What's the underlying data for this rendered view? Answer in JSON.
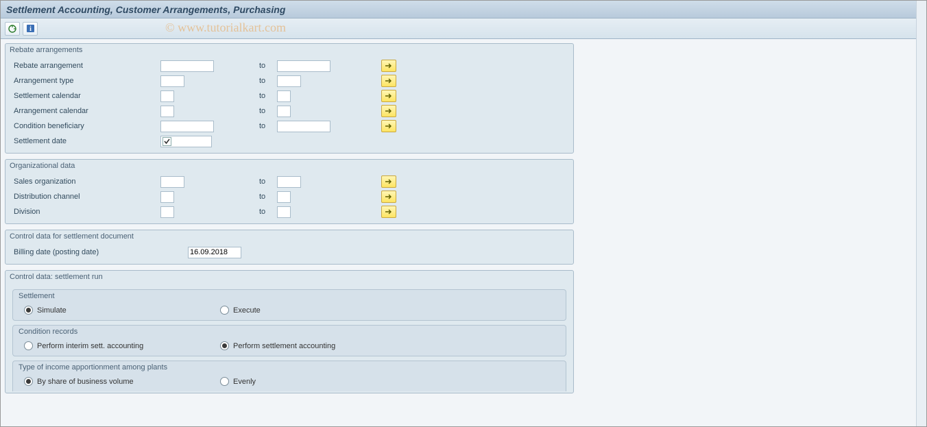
{
  "header": {
    "title": "Settlement Accounting, Customer Arrangements, Purchasing"
  },
  "watermark": "© www.tutorialkart.com",
  "toolbar": {
    "execute_icon": "execute",
    "info_icon": "info"
  },
  "groups": {
    "rebate": {
      "title": "Rebate arrangements",
      "rows": {
        "rebate_arrangement": {
          "label": "Rebate arrangement",
          "to": "to",
          "from_val": "",
          "to_val": "",
          "width": "med"
        },
        "arrangement_type": {
          "label": "Arrangement type",
          "to": "to",
          "from_val": "",
          "to_val": "",
          "width": "narrow"
        },
        "settlement_cal": {
          "label": "Settlement calendar",
          "to": "to",
          "from_val": "",
          "to_val": "",
          "width": "narrow"
        },
        "arrangement_cal": {
          "label": "Arrangement calendar",
          "to": "to",
          "from_val": "",
          "to_val": "",
          "width": "narrow"
        },
        "cond_beneficiary": {
          "label": "Condition beneficiary",
          "to": "to",
          "from_val": "",
          "to_val": "",
          "width": "med"
        },
        "settlement_date": {
          "label": "Settlement date",
          "checked": true
        }
      }
    },
    "org": {
      "title": "Organizational data",
      "rows": {
        "sales_org": {
          "label": "Sales organization",
          "to": "to",
          "from_val": "",
          "to_val": "",
          "width": "narrow"
        },
        "dist_channel": {
          "label": "Distribution channel",
          "to": "to",
          "from_val": "",
          "to_val": "",
          "width": "narrow"
        },
        "division": {
          "label": "Division",
          "to": "to",
          "from_val": "",
          "to_val": "",
          "width": "narrow"
        }
      }
    },
    "control_doc": {
      "title": "Control data for settlement document",
      "rows": {
        "billing_date": {
          "label": "Billing date (posting date)",
          "value": "16.09.2018"
        }
      }
    },
    "control_run": {
      "title": "Control data: settlement run",
      "subs": {
        "settlement": {
          "title": "Settlement",
          "opts": {
            "simulate": "Simulate",
            "execute": "Execute"
          },
          "selected": "simulate"
        },
        "cond_records": {
          "title": "Condition records",
          "opts": {
            "interim": "Perform interim sett. accounting",
            "final": "Perform settlement accounting"
          },
          "selected": "final"
        },
        "income_apportion": {
          "title": "Type of income apportionment among plants",
          "opts": {
            "by_share": "By share of business volume",
            "evenly": "Evenly"
          },
          "selected": "by_share"
        }
      }
    }
  }
}
